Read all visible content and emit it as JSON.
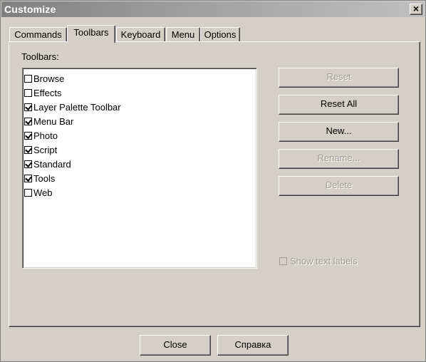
{
  "window": {
    "title": "Customize",
    "close_glyph": "×"
  },
  "tabs": [
    {
      "label": "Commands",
      "active": false
    },
    {
      "label": "Toolbars",
      "active": true
    },
    {
      "label": "Keyboard",
      "active": false
    },
    {
      "label": "Menu",
      "active": false
    },
    {
      "label": "Options",
      "active": false
    }
  ],
  "toolbars_panel": {
    "label": "Toolbars:",
    "items": [
      {
        "label": "Browse",
        "checked": false
      },
      {
        "label": "Effects",
        "checked": false
      },
      {
        "label": "Layer Palette Toolbar",
        "checked": true
      },
      {
        "label": "Menu Bar",
        "checked": true
      },
      {
        "label": "Photo",
        "checked": true
      },
      {
        "label": "Script",
        "checked": true
      },
      {
        "label": "Standard",
        "checked": true
      },
      {
        "label": "Tools",
        "checked": true
      },
      {
        "label": "Web",
        "checked": false
      }
    ],
    "buttons": {
      "reset": {
        "label": "Reset",
        "enabled": false
      },
      "reset_all": {
        "label": "Reset All",
        "enabled": true
      },
      "new": {
        "label": "New...",
        "enabled": true
      },
      "rename": {
        "label": "Rename...",
        "enabled": false
      },
      "delete": {
        "label": "Delete",
        "enabled": false
      }
    },
    "show_text_labels": {
      "label": "Show text labels",
      "checked": false,
      "enabled": false
    }
  },
  "footer": {
    "close_label": "Close",
    "help_label": "Справка"
  }
}
